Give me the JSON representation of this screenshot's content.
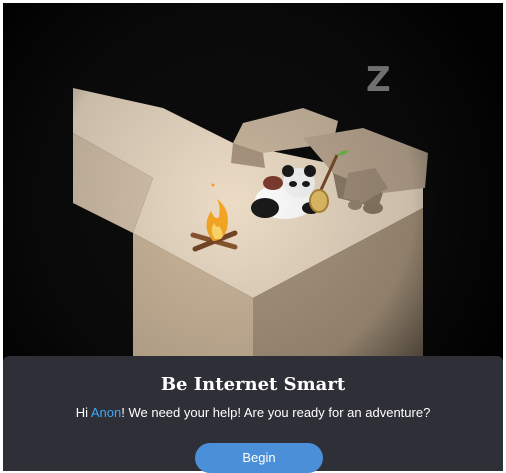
{
  "scene": {
    "sleep_indicator": "Z",
    "character": "sleeping-panda",
    "props": [
      "campfire",
      "stick-with-leaf",
      "round-shield",
      "rocks"
    ]
  },
  "dialog": {
    "title": "Be Internet Smart",
    "message_prefix": "Hi ",
    "player_name": "Anon",
    "message_suffix": "! We need your help! Are you ready for an adventure?",
    "begin_label": "Begin"
  },
  "colors": {
    "background": "#0c0c0c",
    "dialog_bg": "#2e2f37",
    "name_highlight": "#3fa9f5",
    "button_bg": "#4a8fd8"
  }
}
